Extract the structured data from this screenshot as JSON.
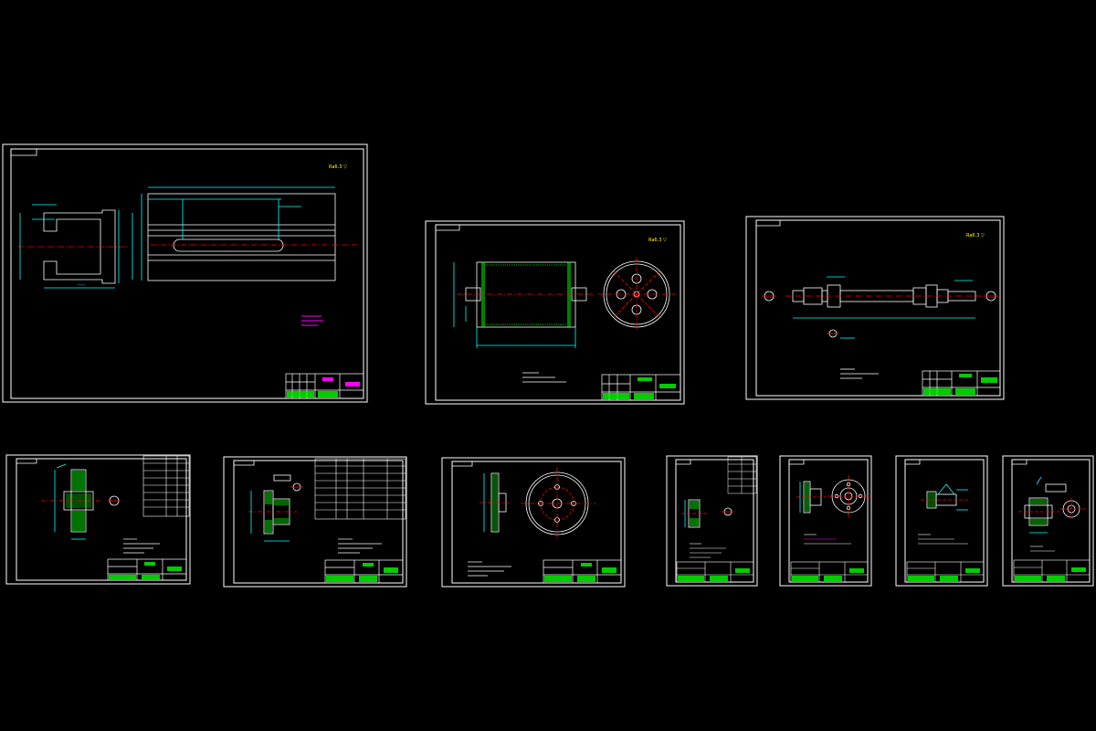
{
  "colors": {
    "background": "#000000",
    "frame": "#ffffff",
    "geometry": "#ffffff",
    "dimension": "#00ffff",
    "centerline": "#ff0000",
    "hatch": "#00ff00",
    "titleblock": "#00ff00",
    "note_magenta": "#ff00ff",
    "roughness": "#ffff00"
  },
  "roughness_marks": [
    {
      "id": "sheet-1",
      "text": "Ra6.3 ▽"
    },
    {
      "id": "sheet-2",
      "text": "Ra6.3 ▽"
    },
    {
      "id": "sheet-3",
      "text": "Ra6.3 ▽"
    }
  ],
  "sheets": [
    {
      "id": "sheet-1",
      "view": "shaft-with-keyway"
    },
    {
      "id": "sheet-2",
      "view": "drum-with-flange"
    },
    {
      "id": "sheet-3",
      "view": "long-shaft"
    },
    {
      "id": "sheet-4",
      "view": "gear-section"
    },
    {
      "id": "sheet-5",
      "view": "gear-hub-section"
    },
    {
      "id": "sheet-6",
      "view": "disc-flange"
    },
    {
      "id": "sheet-7",
      "view": "small-gear"
    },
    {
      "id": "sheet-8",
      "view": "flange-bearing"
    },
    {
      "id": "sheet-9",
      "view": "bushing"
    },
    {
      "id": "sheet-10",
      "view": "coupling"
    }
  ]
}
